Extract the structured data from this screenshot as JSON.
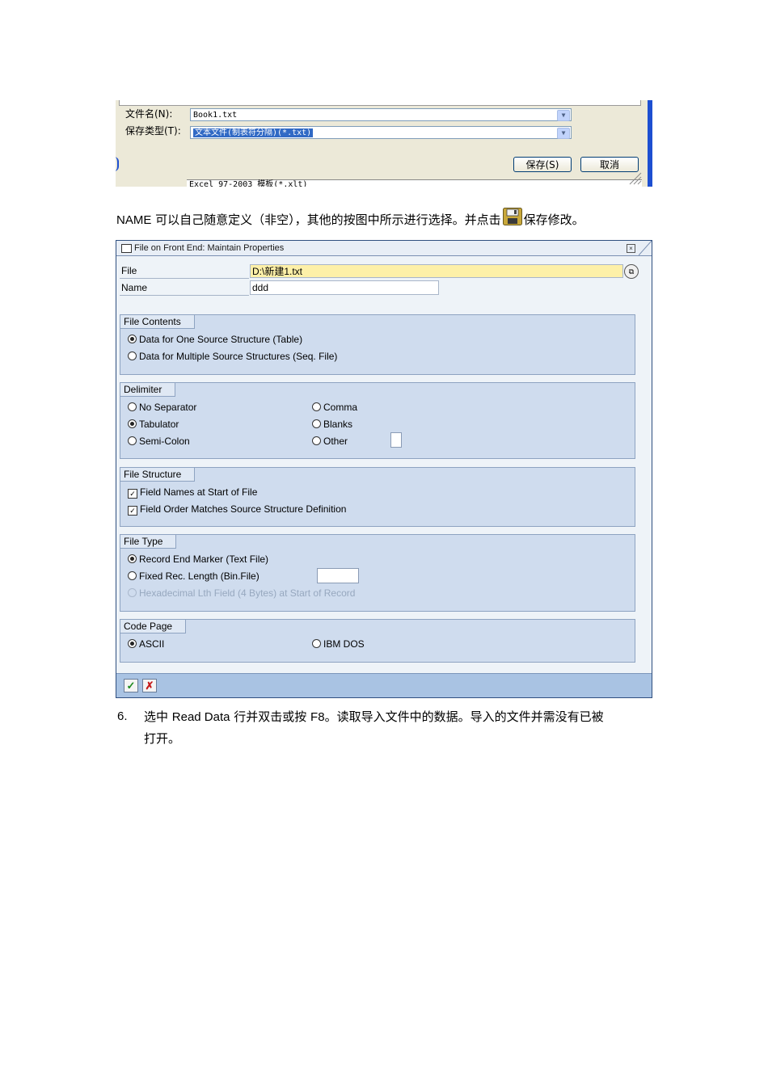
{
  "save_dialog": {
    "filename_label": "文件名(N):",
    "filename_value": "Book1.txt",
    "filetype_label": "保存类型(T):",
    "filetype_value": "文本文件(制表符分隔)(*.txt)",
    "save_button": "保存(S)",
    "cancel_button": "取消",
    "partial_list_item": "Excel 97-2003 模板(*.xlt)"
  },
  "paragraph": {
    "prefix_latin": "NAME",
    "text_before_icon": " 可以自己随意定义（非空），其他的按图中所示进行选择。并点击",
    "text_after_icon": "保存修改。",
    "icon": "save-floppy-icon"
  },
  "sap_window": {
    "title": "File on Front End: Maintain Properties",
    "file_label": "File",
    "file_value": "D:\\新建1.txt",
    "name_label": "Name",
    "name_value": "ddd",
    "file_contents": {
      "title": "File Contents",
      "options": [
        {
          "label": "Data for One Source Structure (Table)",
          "selected": true
        },
        {
          "label": "Data for Multiple Source Structures (Seq. File)",
          "selected": false
        }
      ]
    },
    "delimiter": {
      "title": "Delimiter",
      "options": [
        {
          "label": "No Separator",
          "selected": false
        },
        {
          "label": "Tabulator",
          "selected": true
        },
        {
          "label": "Semi-Colon",
          "selected": false
        },
        {
          "label": "Comma",
          "selected": false
        },
        {
          "label": "Blanks",
          "selected": false
        },
        {
          "label": "Other",
          "selected": false
        }
      ]
    },
    "file_structure": {
      "title": "File Structure",
      "options": [
        {
          "label": "Field Names at Start of File",
          "checked": true
        },
        {
          "label": "Field Order Matches Source Structure Definition",
          "checked": true
        }
      ]
    },
    "file_type": {
      "title": "File Type",
      "options": [
        {
          "label": "Record End Marker (Text File)",
          "selected": true
        },
        {
          "label": "Fixed Rec. Length (Bin.File)",
          "selected": false
        },
        {
          "label": "Hexadecimal Lth Field (4 Bytes) at Start of Record",
          "selected": false,
          "disabled": true
        }
      ]
    },
    "code_page": {
      "title": "Code Page",
      "options": [
        {
          "label": "ASCII",
          "selected": true
        },
        {
          "label": "IBM DOS",
          "selected": false
        }
      ]
    },
    "footer": {
      "ok_icon": "checkmark-icon",
      "cancel_icon": "cancel-x-icon"
    }
  },
  "step6": {
    "number": "6.",
    "t1": "选中 ",
    "l1": "Read Data",
    "t2": " 行并双击或按 ",
    "l2": "F8",
    "t3": "。读取导入文件中的数据。导入的文件并需没有已被",
    "line2": "打开。"
  }
}
